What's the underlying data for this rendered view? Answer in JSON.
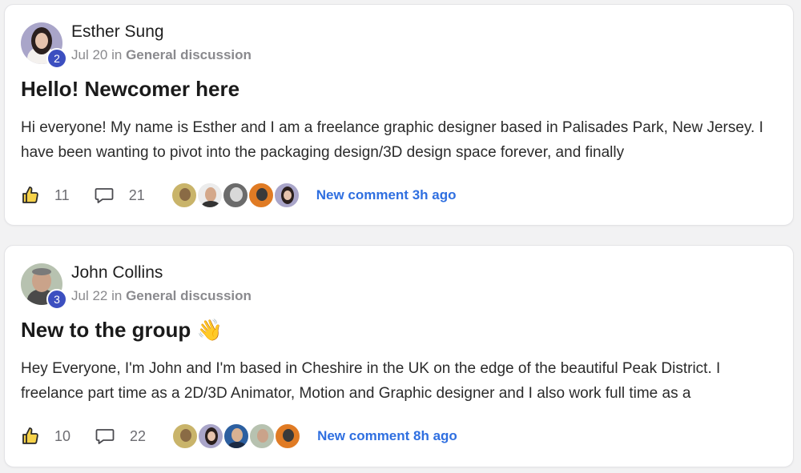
{
  "posts": [
    {
      "author": "Esther Sung",
      "level": "2",
      "date": "Jul 20",
      "in_word": "in",
      "category": "General discussion",
      "title": "Hello! Newcomer here",
      "excerpt": "Hi everyone! My name is Esther and I am a freelance graphic designer based in Palisades Park, New Jersey. I have been wanting to pivot into the packaging design/3D design space forever, and finally",
      "likes": "11",
      "comments": "21",
      "new_comment": "New comment 3h ago"
    },
    {
      "author": "John Collins",
      "level": "3",
      "date": "Jul 22",
      "in_word": "in",
      "category": "General discussion",
      "title": "New to the group 👋",
      "excerpt": "Hey Everyone, I'm John and I'm based in Cheshire in the UK on the edge of the beautiful Peak District. I freelance part time as a 2D/3D Animator, Motion and Graphic designer and I also work full time as a",
      "likes": "10",
      "comments": "22",
      "new_comment": "New comment 8h ago"
    }
  ],
  "icons": {
    "like": "thumbs-up-icon",
    "comment": "comment-bubble-icon"
  },
  "colors": {
    "level_badge": "#3c4fc0",
    "new_comment_link": "#2f6fe0"
  }
}
